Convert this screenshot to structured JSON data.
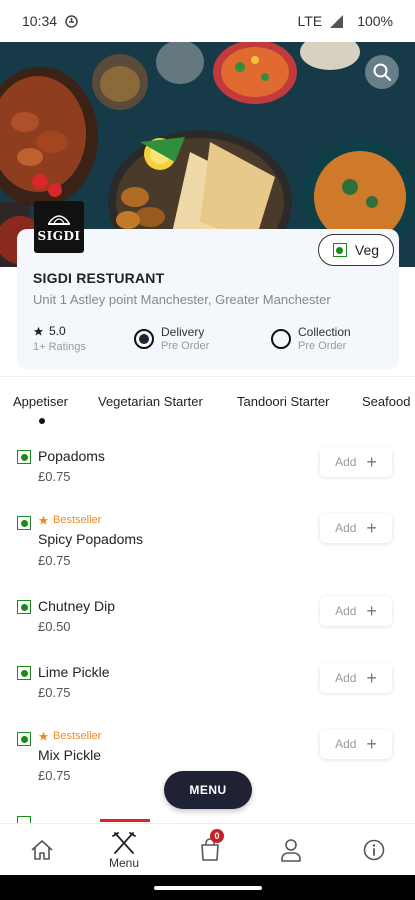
{
  "status_bar": {
    "time": "10:34",
    "network": "LTE",
    "battery": "100%"
  },
  "restaurant": {
    "logo_text": "SIGDI",
    "name": "SIGDI RESTURANT",
    "address": "Unit 1 Astley point Manchester, Greater Manchester",
    "rating": "5.0",
    "ratings_count": "1+ Ratings"
  },
  "veg_toggle": {
    "label": "Veg"
  },
  "order_options": [
    {
      "title": "Delivery",
      "subtitle": "Pre Order",
      "selected": true
    },
    {
      "title": "Collection",
      "subtitle": "Pre Order",
      "selected": false
    }
  ],
  "tabs": [
    "Appetiser",
    "Vegetarian Starter",
    "Tandoori Starter",
    "Seafood"
  ],
  "active_tab": "Appetiser",
  "items": [
    {
      "name": "Popadoms",
      "price": "£0.75",
      "tag": ""
    },
    {
      "name": "Spicy Popadoms",
      "price": "£0.75",
      "tag": "Bestseller"
    },
    {
      "name": "Chutney Dip",
      "price": "£0.50",
      "tag": ""
    },
    {
      "name": "Lime Pickle",
      "price": "£0.75",
      "tag": ""
    },
    {
      "name": "Mix Pickle",
      "price": "£0.75",
      "tag": "Bestseller"
    }
  ],
  "add_label": "Add",
  "menu_button": "MENU",
  "bottom_nav": {
    "menu_label": "Menu",
    "cart_count": "0"
  },
  "colors": {
    "accent": "#1f2235",
    "veg": "#1a8b1a",
    "bestseller": "#f08a24",
    "badge": "#c8202a"
  },
  "icons": [
    "search-icon",
    "home-icon",
    "menu-cutlery-icon",
    "cart-icon",
    "profile-icon",
    "info-icon",
    "star-icon",
    "plus-icon"
  ]
}
